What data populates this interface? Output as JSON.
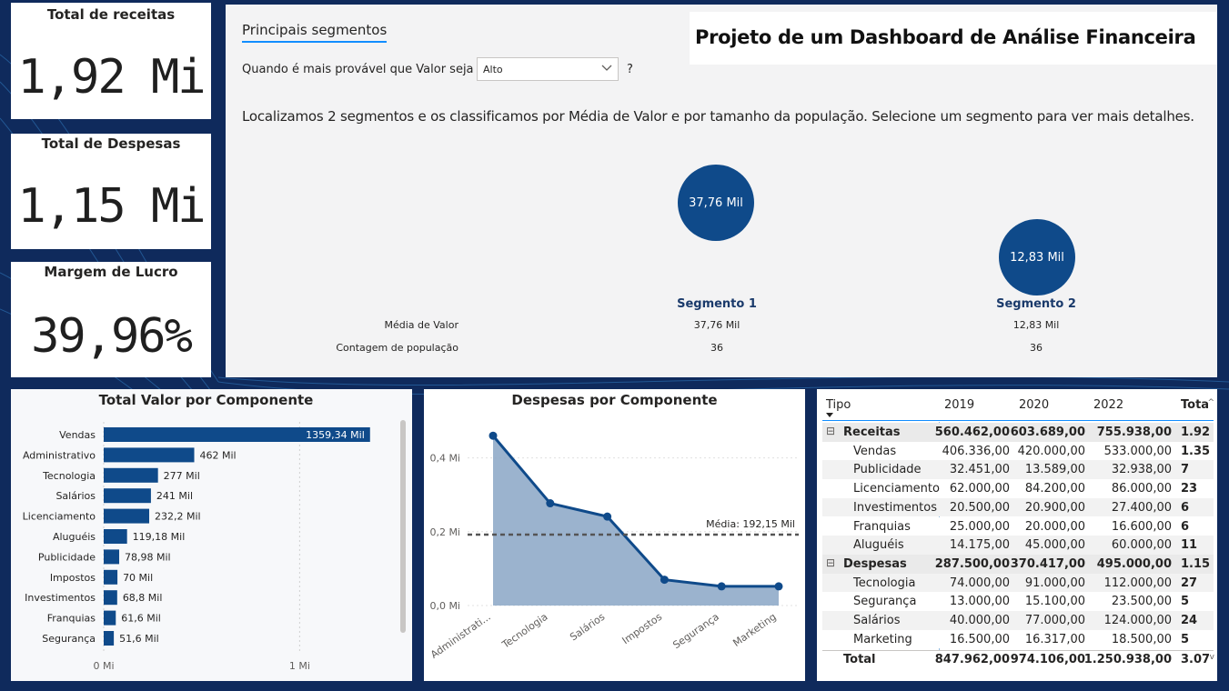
{
  "kpis": [
    {
      "title": "Total de receitas",
      "value": "1,92 Mi"
    },
    {
      "title": "Total de Despesas",
      "value": "1,15 Mi"
    },
    {
      "title": "Margem de Lucro",
      "value": "39,96%"
    }
  ],
  "segments_panel": {
    "tab_label": "Principais segmentos",
    "filter_label": "Quando é mais provável que Valor seja",
    "filter_value": "Alto",
    "help_mark": "?",
    "report_title": "Projeto de um Dashboard de Análise Financeira",
    "description": "Localizamos 2 segmentos e os classificamos por Média de Valor e por tamanho da população. Selecione um segmento para ver mais detalhes.",
    "row_labels": [
      "Média de Valor",
      "Contagem de população"
    ],
    "segments": [
      {
        "name": "Segmento 1",
        "bubble_label": "37,76 Mil",
        "media": "37,76 Mil",
        "contagem": "36"
      },
      {
        "name": "Segmento 2",
        "bubble_label": "12,83 Mil",
        "media": "12,83 Mil",
        "contagem": "36"
      }
    ]
  },
  "bar_chart": {
    "title": "Total Valor por Componente",
    "chart_data": {
      "type": "bar",
      "orientation": "horizontal",
      "categories": [
        "Vendas",
        "Administrativo",
        "Tecnologia",
        "Salários",
        "Licenciamento",
        "Aluguéis",
        "Publicidade",
        "Impostos",
        "Investimentos",
        "Franquias",
        "Segurança"
      ],
      "values": [
        1359.34,
        462,
        277,
        241,
        232.2,
        119.18,
        78.98,
        70,
        68.8,
        61.6,
        51.6
      ],
      "value_labels": [
        "1359,34 Mil",
        "462 Mil",
        "277 Mil",
        "241 Mil",
        "232,2 Mil",
        "119,18 Mil",
        "78,98 Mil",
        "70 Mil",
        "68,8 Mil",
        "61,6 Mil",
        "51,6 Mil"
      ],
      "unit": "Mil",
      "xlim": [
        0,
        1300
      ],
      "xticks": [
        {
          "value": 0,
          "label": "0 Mi"
        },
        {
          "value": 1000,
          "label": "1 Mi"
        }
      ],
      "color": "#0f4a8a"
    }
  },
  "area_chart": {
    "title": "Despesas por Componente",
    "chart_data": {
      "type": "area",
      "categories": [
        "Administrati...",
        "Tecnologia",
        "Salários",
        "Impostos",
        "Segurança",
        "Marketing"
      ],
      "values": [
        0.46,
        0.277,
        0.241,
        0.07,
        0.052,
        0.052
      ],
      "unit": "Mi",
      "ylim": [
        0,
        0.5
      ],
      "yticks": [
        {
          "value": 0,
          "label": "0,0 Mi"
        },
        {
          "value": 0.2,
          "label": "0,2 Mi"
        },
        {
          "value": 0.4,
          "label": "0,4 Mi"
        }
      ],
      "average_line": {
        "value": 0.19215,
        "label": "Média: 192,15 Mil"
      },
      "color": "#0f4a8a",
      "fill": "#8aa6c5"
    }
  },
  "matrix": {
    "headers": [
      "Tipo",
      "2019",
      "2020",
      "2022",
      "Tota"
    ],
    "rows": [
      {
        "label": "Receitas",
        "level": 0,
        "values": [
          "560.462,00",
          "603.689,00",
          "755.938,00",
          "1.92"
        ]
      },
      {
        "label": "Vendas",
        "level": 1,
        "values": [
          "406.336,00",
          "420.000,00",
          "533.000,00",
          "1.35"
        ]
      },
      {
        "label": "Publicidade",
        "level": 1,
        "values": [
          "32.451,00",
          "13.589,00",
          "32.938,00",
          "7"
        ]
      },
      {
        "label": "Licenciamento",
        "level": 1,
        "values": [
          "62.000,00",
          "84.200,00",
          "86.000,00",
          "23"
        ]
      },
      {
        "label": "Investimentos",
        "level": 1,
        "values": [
          "20.500,00",
          "20.900,00",
          "27.400,00",
          "6"
        ]
      },
      {
        "label": "Franquias",
        "level": 1,
        "values": [
          "25.000,00",
          "20.000,00",
          "16.600,00",
          "6"
        ]
      },
      {
        "label": "Aluguéis",
        "level": 1,
        "values": [
          "14.175,00",
          "45.000,00",
          "60.000,00",
          "11"
        ]
      },
      {
        "label": "Despesas",
        "level": 0,
        "values": [
          "287.500,00",
          "370.417,00",
          "495.000,00",
          "1.15"
        ]
      },
      {
        "label": "Tecnologia",
        "level": 1,
        "values": [
          "74.000,00",
          "91.000,00",
          "112.000,00",
          "27"
        ]
      },
      {
        "label": "Segurança",
        "level": 1,
        "values": [
          "13.000,00",
          "15.100,00",
          "23.500,00",
          "5"
        ]
      },
      {
        "label": "Salários",
        "level": 1,
        "values": [
          "40.000,00",
          "77.000,00",
          "124.000,00",
          "24"
        ]
      },
      {
        "label": "Marketing",
        "level": 1,
        "values": [
          "16.500,00",
          "16.317,00",
          "18.500,00",
          "5"
        ]
      }
    ],
    "total": {
      "label": "Total",
      "values": [
        "847.962,00",
        "974.106,00",
        "1.250.938,00",
        "3.07"
      ]
    },
    "collapse_symbol": "⊟"
  }
}
